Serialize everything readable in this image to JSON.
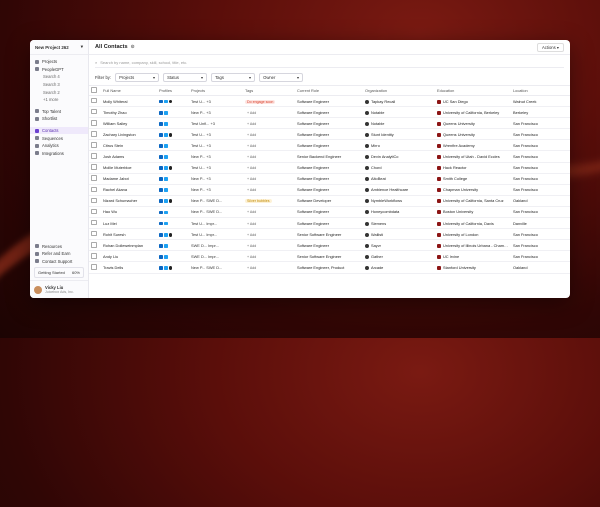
{
  "colors": {
    "accent": "#6b3fd0",
    "tag_red_bg": "#fde4e1",
    "tag_red_fg": "#d9402b",
    "tag_yellow_bg": "#fdf1d6",
    "tag_yellow_fg": "#c08a00"
  },
  "sidebar": {
    "project_name": "New Project 262",
    "items": [
      {
        "label": "Projects",
        "icon": "folder-icon",
        "sub": false
      },
      {
        "label": "PeopleGPT",
        "icon": "sparkle-icon",
        "sub": false
      },
      {
        "label": "Search 4",
        "icon": "",
        "sub": true
      },
      {
        "label": "Search 3",
        "icon": "",
        "sub": true
      },
      {
        "label": "Search 2",
        "icon": "",
        "sub": true
      },
      {
        "label": "+1 more",
        "icon": "",
        "sub": true
      },
      {
        "label": "Top Talent",
        "icon": "star-icon",
        "sub": false
      },
      {
        "label": "Shortlist",
        "icon": "bookmark-icon",
        "sub": false
      },
      {
        "label": "Contacts",
        "icon": "contacts-icon",
        "sub": false,
        "active": true
      },
      {
        "label": "Sequences",
        "icon": "send-icon",
        "sub": false
      },
      {
        "label": "Analytics",
        "icon": "chart-icon",
        "sub": false
      },
      {
        "label": "Integrations",
        "icon": "plug-icon",
        "sub": false
      }
    ],
    "bottom_items": [
      {
        "label": "Resources",
        "icon": "book-icon"
      },
      {
        "label": "Refer and Earn",
        "icon": "gift-icon"
      },
      {
        "label": "Contact Support",
        "icon": "help-icon"
      }
    ],
    "getting_started": {
      "label": "Getting Started",
      "progress": "60%"
    },
    "user": {
      "name": "Vicky Liu",
      "org": "Juicebox Ads, Inc."
    }
  },
  "header": {
    "title": "All Contacts",
    "actions_label": "Actions"
  },
  "search": {
    "placeholder": "Search by name, company, skill, school, title, etc."
  },
  "filters": {
    "label": "Filter by:",
    "buttons": [
      "Projects",
      "Status",
      "Tags",
      "Owner"
    ]
  },
  "table": {
    "columns": [
      "Full Name",
      "Profiles",
      "Projects",
      "Tags",
      "Current Role",
      "Organization",
      "Education",
      "Location"
    ],
    "rows": [
      {
        "name": "Molly Whiteral",
        "projects": "Test U... +3",
        "tags": "Do engage soon",
        "tag_color": "red",
        "role": "Software Engineer",
        "org": "Tapkay Recall",
        "edu": "UC San Diego",
        "loc": "Walnut Creek"
      },
      {
        "name": "Timothy Zhao",
        "projects": "New P... +3",
        "tags": "+ Add",
        "tag_color": "",
        "role": "Software Engineer",
        "org": "Notable",
        "edu": "University of California, Berkeley",
        "loc": "Berkeley"
      },
      {
        "name": "William Salley",
        "projects": "Test Unfi... +3",
        "tags": "+ Add",
        "tag_color": "",
        "role": "Software Engineer",
        "org": "Notable",
        "edu": "Queens University",
        "loc": "San Francisco"
      },
      {
        "name": "Zachary Livingston",
        "projects": "Test U... +3",
        "tags": "+ Add",
        "tag_color": "",
        "role": "Software Engineer",
        "org": "Stunt Identity",
        "edu": "Queens University",
        "loc": "San Francisco"
      },
      {
        "name": "Citrus Stein",
        "projects": "Test U... +3",
        "tags": "+ Add",
        "tag_color": "",
        "role": "Software Engineer",
        "org": "Mirro",
        "edu": "Wrenfire Academy",
        "loc": "San Francisco"
      },
      {
        "name": "Josh Adams",
        "projects": "New P... +3",
        "tags": "+ Add",
        "tag_color": "",
        "role": "Senior Backend Engineer",
        "org": "Devin AnalytiCo",
        "edu": "University of Utah - David Eccles",
        "loc": "San Francisco"
      },
      {
        "name": "Mollie Muterbloe",
        "projects": "Test U... +3",
        "tags": "+ Add",
        "tag_color": "",
        "role": "Software Engineer",
        "org": "Chord",
        "edu": "Hack Reactor",
        "loc": "San Francisco"
      },
      {
        "name": "Madame Jabot",
        "projects": "New P... +3",
        "tags": "+ Add",
        "tag_color": "",
        "role": "Software Engineer",
        "org": "AltoBeat",
        "edu": "Smith College",
        "loc": "San Francisco"
      },
      {
        "name": "Rachel Akana",
        "projects": "New P... +3",
        "tags": "+ Add",
        "tag_color": "",
        "role": "Software Engineer",
        "org": "Ambience Healthcare",
        "edu": "Chapman University",
        "loc": "San Francisco"
      },
      {
        "name": "Nizard Schumacher",
        "projects": "New P... SWE D...",
        "tags": "Silver bubbles",
        "tag_color": "yellow",
        "role": "Software Developer",
        "org": "NymbleWorkflows",
        "edu": "University of California, Santa Cruz",
        "loc": "Oakland"
      },
      {
        "name": "Hao Wu",
        "projects": "New P... SWE D...",
        "tags": "+ Add",
        "tag_color": "",
        "role": "Software Engineer",
        "org": "Honeycombdata",
        "edu": "Boston University",
        "loc": "San Francisco"
      },
      {
        "name": "Luz Mei",
        "projects": "Test U... Impr...",
        "tags": "+ Add",
        "tag_color": "",
        "role": "Software Engineer",
        "org": "Siemens",
        "edu": "University of California, Davis",
        "loc": "Danville"
      },
      {
        "name": "Rohit Suresh",
        "projects": "Test U... Impr...",
        "tags": "+ Add",
        "tag_color": "",
        "role": "Senior Software Engineer",
        "org": "Wallisti",
        "edu": "University of London",
        "loc": "San Francisco"
      },
      {
        "name": "Rohan Dolleweinmplan",
        "projects": "SWE D... Impr...",
        "tags": "+ Add",
        "tag_color": "",
        "role": "Software Engineer",
        "org": "Sayvr",
        "edu": "University of Illinois Urbana - Champaign",
        "loc": "San Francisco"
      },
      {
        "name": "Andy Liu",
        "projects": "SWE D... Impr...",
        "tags": "+ Add",
        "tag_color": "",
        "role": "Senior Software Engineer",
        "org": "Gather",
        "edu": "UC Irvine",
        "loc": "San Francisco"
      },
      {
        "name": "Travis Dells",
        "projects": "New P... SWE D...",
        "tags": "+ Add",
        "tag_color": "",
        "role": "Software Engineer, Product",
        "org": "Arcade",
        "edu": "Stanford University",
        "loc": "Oakland"
      }
    ]
  }
}
